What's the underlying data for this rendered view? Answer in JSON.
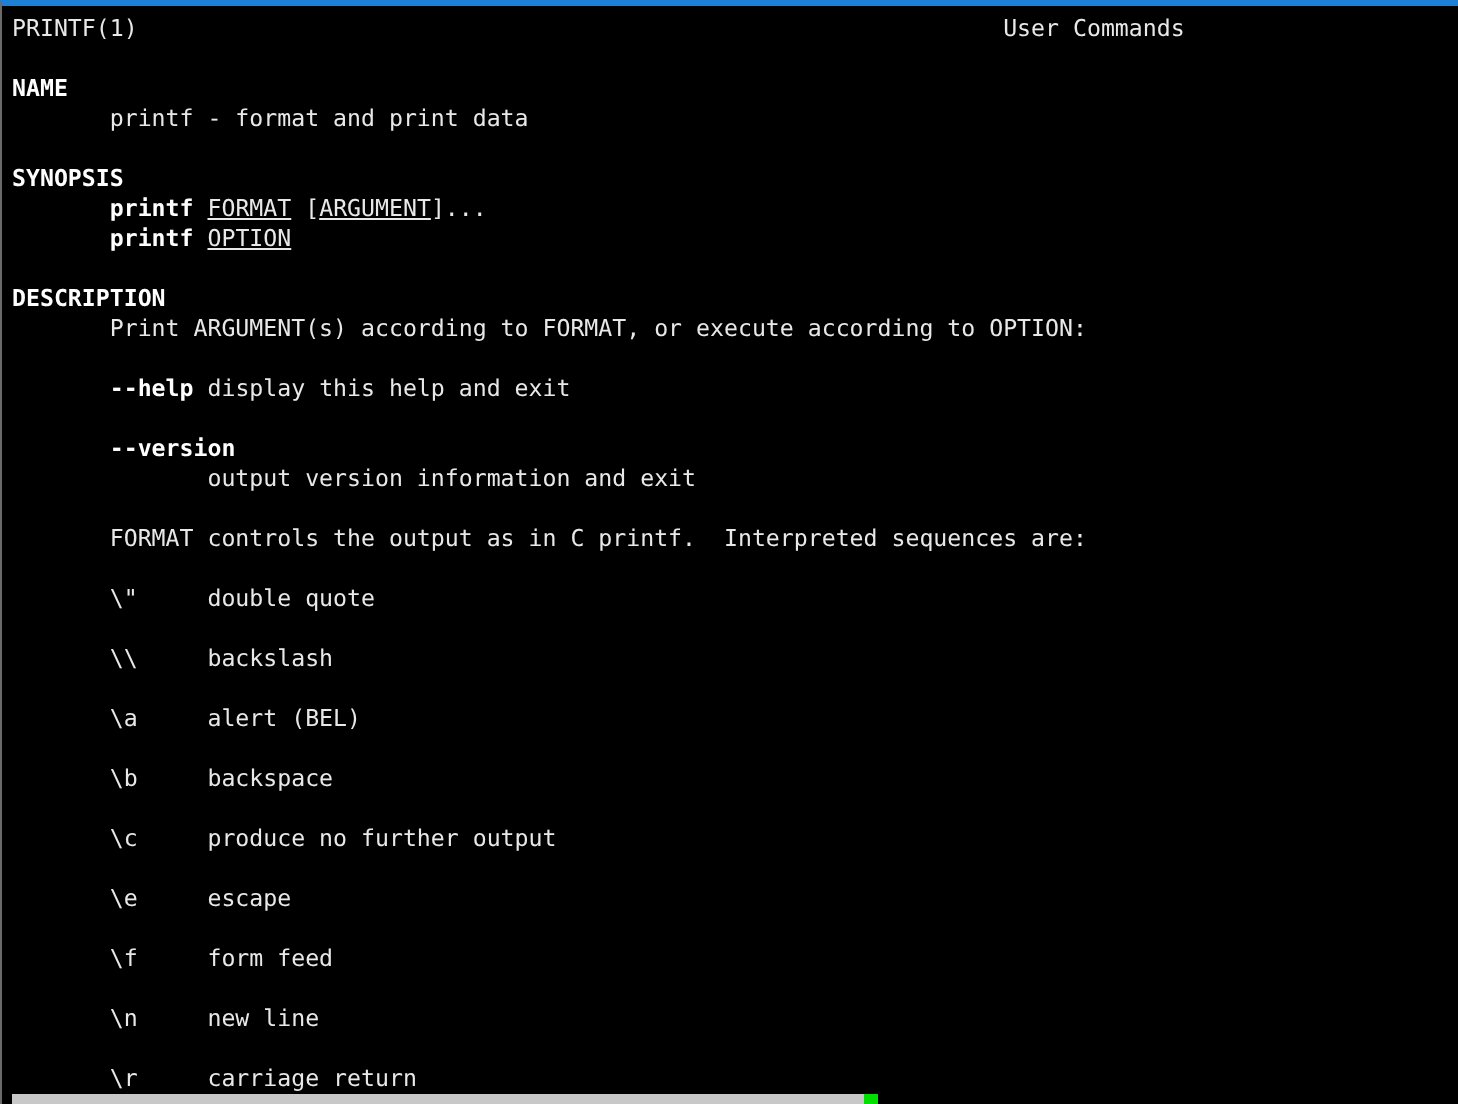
{
  "header": {
    "left": "PRINTF(1)",
    "center": "User Commands"
  },
  "sections": [
    {
      "heading": "NAME",
      "blocks": [
        [
          {
            "kind": "para",
            "segments": [
              {
                "kind": "plain",
                "text": "printf - format and print data"
              }
            ]
          }
        ]
      ]
    },
    {
      "heading": "SYNOPSIS",
      "blocks": [
        [
          {
            "kind": "para",
            "segments": [
              {
                "kind": "bold",
                "text": "printf "
              },
              {
                "kind": "underline",
                "text": "FORMAT"
              },
              {
                "kind": "plain",
                "text": " ["
              },
              {
                "kind": "underline",
                "text": "ARGUMENT"
              },
              {
                "kind": "plain",
                "text": "]..."
              }
            ]
          },
          {
            "kind": "para",
            "segments": [
              {
                "kind": "bold",
                "text": "printf "
              },
              {
                "kind": "underline",
                "text": "OPTION"
              }
            ]
          }
        ]
      ]
    },
    {
      "heading": "DESCRIPTION",
      "blocks": [
        [
          {
            "kind": "para",
            "segments": [
              {
                "kind": "plain",
                "text": "Print ARGUMENT(s) according to FORMAT, or execute according to OPTION:"
              }
            ]
          }
        ],
        [
          {
            "kind": "para",
            "segments": [
              {
                "kind": "bold",
                "text": "--help"
              },
              {
                "kind": "plain",
                "text": " display this help and exit"
              }
            ]
          }
        ],
        [
          {
            "kind": "para",
            "segments": [
              {
                "kind": "bold",
                "text": "--version"
              }
            ]
          },
          {
            "kind": "subpara",
            "segments": [
              {
                "kind": "plain",
                "text": "output version information and exit"
              }
            ]
          }
        ],
        [
          {
            "kind": "para",
            "segments": [
              {
                "kind": "plain",
                "text": "FORMAT controls the output as in C printf.  Interpreted sequences are:"
              }
            ]
          }
        ],
        [
          {
            "kind": "escape",
            "code": "\\\"",
            "desc": "double quote"
          }
        ],
        [
          {
            "kind": "escape",
            "code": "\\\\",
            "desc": "backslash"
          }
        ],
        [
          {
            "kind": "escape",
            "code": "\\a",
            "desc": "alert (BEL)"
          }
        ],
        [
          {
            "kind": "escape",
            "code": "\\b",
            "desc": "backspace"
          }
        ],
        [
          {
            "kind": "escape",
            "code": "\\c",
            "desc": "produce no further output"
          }
        ],
        [
          {
            "kind": "escape",
            "code": "\\e",
            "desc": "escape"
          }
        ],
        [
          {
            "kind": "escape",
            "code": "\\f",
            "desc": "form feed"
          }
        ],
        [
          {
            "kind": "escape",
            "code": "\\n",
            "desc": "new line"
          }
        ],
        [
          {
            "kind": "escape",
            "code": "\\r",
            "desc": "carriage return"
          }
        ]
      ]
    }
  ]
}
